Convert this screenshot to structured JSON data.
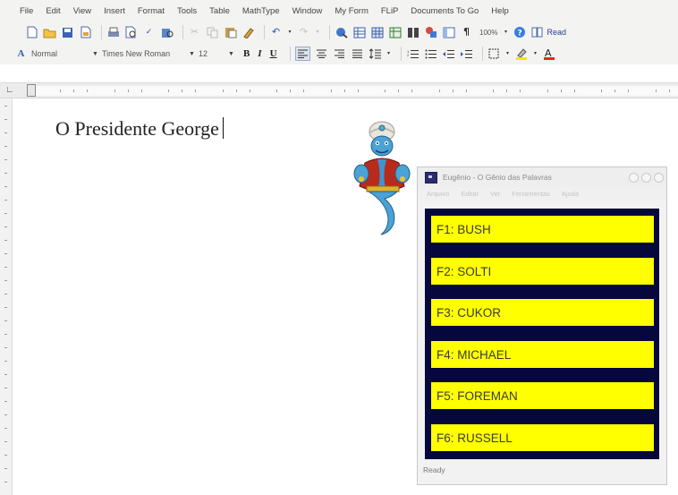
{
  "menubar": {
    "items": [
      "File",
      "Edit",
      "View",
      "Insert",
      "Format",
      "Tools",
      "Table",
      "MathType",
      "Window",
      "My Form",
      "FLiP",
      "Documents To Go",
      "Help"
    ]
  },
  "toolbar_standard": {
    "zoom": "100%",
    "read_label": "Read"
  },
  "toolbar_formatting": {
    "style": "Normal",
    "font": "Times New Roman",
    "size": "12",
    "bold": "B",
    "italic": "I",
    "underline": "U"
  },
  "document": {
    "text": "O Presidente George"
  },
  "eugenio_window": {
    "title": "Eugênio - O Gênio das Palavras",
    "menu": [
      "Arquivo",
      "Editar",
      "Ver",
      "Ferramentas",
      "Ajuda"
    ],
    "panel_color": "#06073d",
    "button_color": "#ffff00",
    "suggestions": [
      "F1: BUSH",
      "F2: SOLTI",
      "F3: CUKOR",
      "F4: MICHAEL",
      "F5: FOREMAN",
      "F6: RUSSELL"
    ],
    "status": "Ready"
  }
}
